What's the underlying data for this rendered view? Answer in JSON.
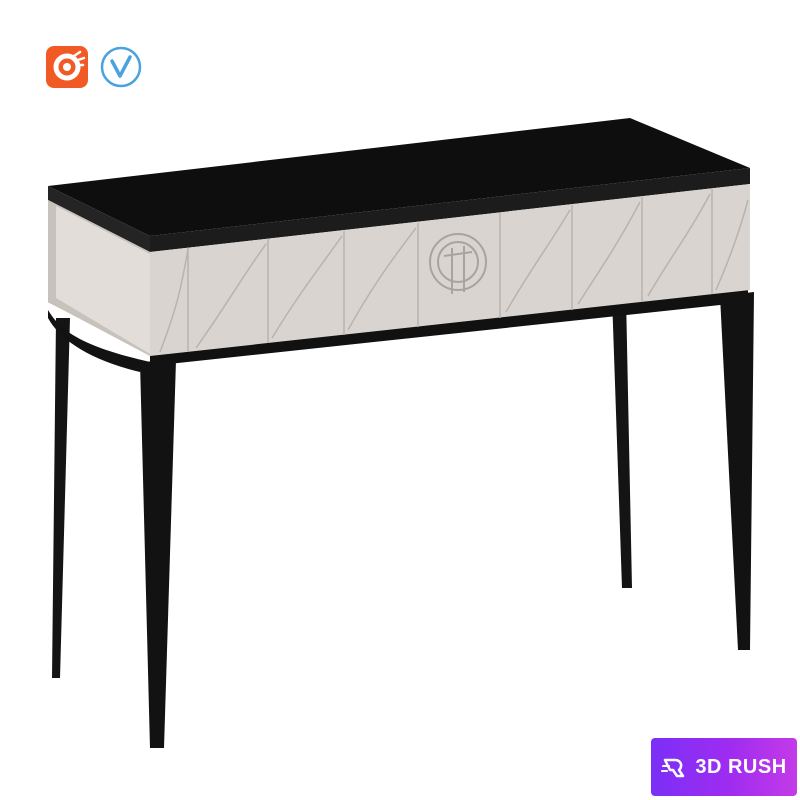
{
  "scene": {
    "subject": "console-table",
    "colors": {
      "tabletop": "#0e0e0e",
      "drawer_panel": "#d9d4cf",
      "drawer_shadow": "#b9b3ad",
      "legs": "#141414",
      "background": "#ffffff"
    }
  },
  "badges": {
    "corona": {
      "icon": "corona-renderer-icon",
      "color": "#f15a24"
    },
    "vray": {
      "icon": "vray-renderer-icon",
      "color": "#4aa3df"
    }
  },
  "watermark": {
    "brand_label": "3D RUSH",
    "icon": "3drush-logo-icon",
    "colors": [
      "#7b2ff7",
      "#c43be8"
    ]
  }
}
